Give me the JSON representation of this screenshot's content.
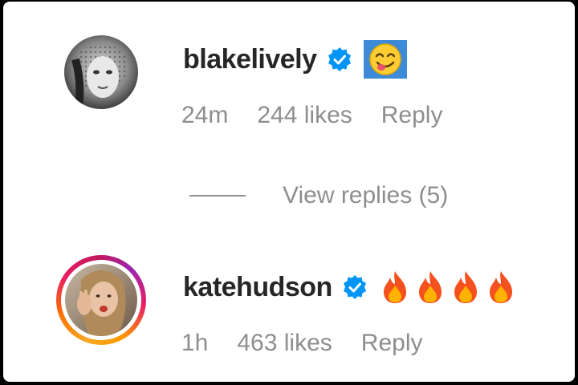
{
  "comments": [
    {
      "username": "blakelively",
      "verified": true,
      "text_emoji": "yum-face-emoji",
      "time": "24m",
      "likes": "244 likes",
      "reply_label": "Reply"
    },
    {
      "username": "katehudson",
      "verified": true,
      "text_emoji": "fire-emoji x4",
      "time": "1h",
      "likes": "463 likes",
      "reply_label": "Reply"
    }
  ],
  "view_replies_label": "View replies (5)",
  "colors": {
    "text_primary": "#262626",
    "text_secondary": "#8e8e8e",
    "verified_blue": "#0095f6",
    "selection_blue": "#3d8bd8"
  }
}
